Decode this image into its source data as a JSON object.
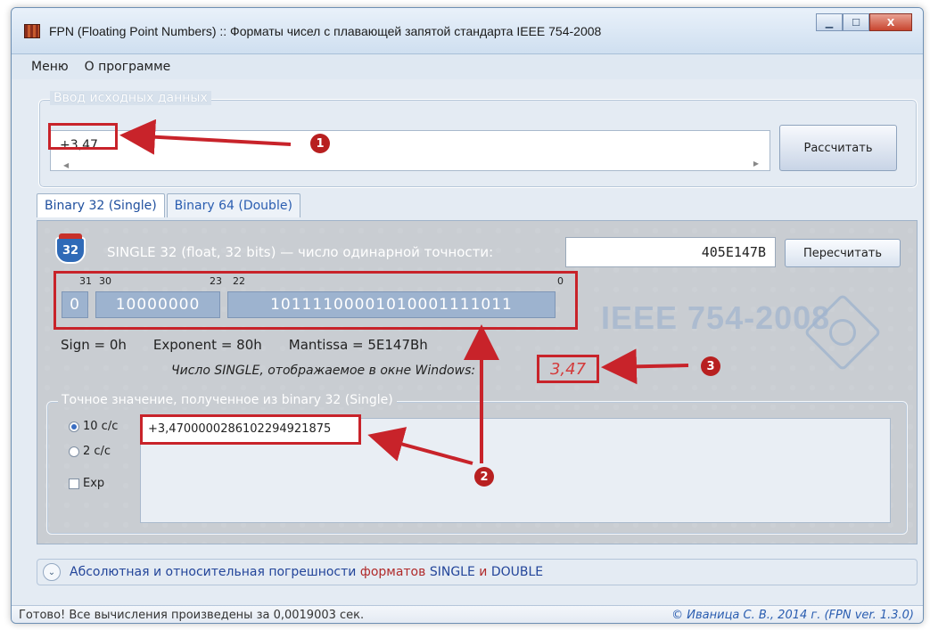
{
  "window": {
    "title": "FPN (Floating Point Numbers) :: Форматы чисел с плавающей запятой стандарта IEEE 754-2008",
    "controls": {
      "minimize": "▁",
      "maximize": "☐",
      "close": "X"
    }
  },
  "menu": [
    "Меню",
    "О программе"
  ],
  "input_group": {
    "legend": "Ввод исходных данных",
    "value": "+3,47",
    "calc_button": "Рассчитать"
  },
  "tabs": [
    {
      "label": "Binary 32 (Single)",
      "active": true
    },
    {
      "label": "Binary 64 (Double)",
      "active": false
    }
  ],
  "single": {
    "badge": "32",
    "title": "SINGLE  32 (float, 32 bits) — число одинарной точности:",
    "hex_value": "405E147B",
    "recalc_button": "Пересчитать",
    "bit_indices": {
      "sign": "31",
      "exp_start": "30",
      "exp_end": "23",
      "man_start": "22",
      "man_end": "0"
    },
    "sign_bits": "0",
    "exponent_bits": "10000000",
    "mantissa_bits": "10111100001010001111011",
    "sign_text": "Sign = 0h",
    "exponent_text": "Exponent = 80h",
    "mantissa_text": "Mantissa = 5E147Bh",
    "windows_label": "Число SINGLE, отображаемое в окне Windows:",
    "windows_value": "3,47",
    "watermark": "IEEE 754-2008"
  },
  "exact": {
    "legend": "Точное значение, полученное из binary 32 (Single)",
    "radio_10": "10 с/с",
    "radio_2": "2 с/с",
    "exp_checkbox": "Exp",
    "value": "+3,4700000286102294921875"
  },
  "expander": {
    "part1": "Абсолютная и относительная погрешности",
    "part2": "форматов",
    "part3": "SINGLE",
    "part4": "и",
    "part5": "DOUBLE"
  },
  "status": {
    "left": "Готово! Все вычисления произведены за 0,0019003 сек.",
    "right": "© Иваница С. В., 2014 г. (FPN ver. 1.3.0)"
  },
  "annotations": [
    "1",
    "2",
    "3"
  ],
  "colors": {
    "annotation_red": "#c8232a",
    "accent_blue": "#2a5db0"
  }
}
